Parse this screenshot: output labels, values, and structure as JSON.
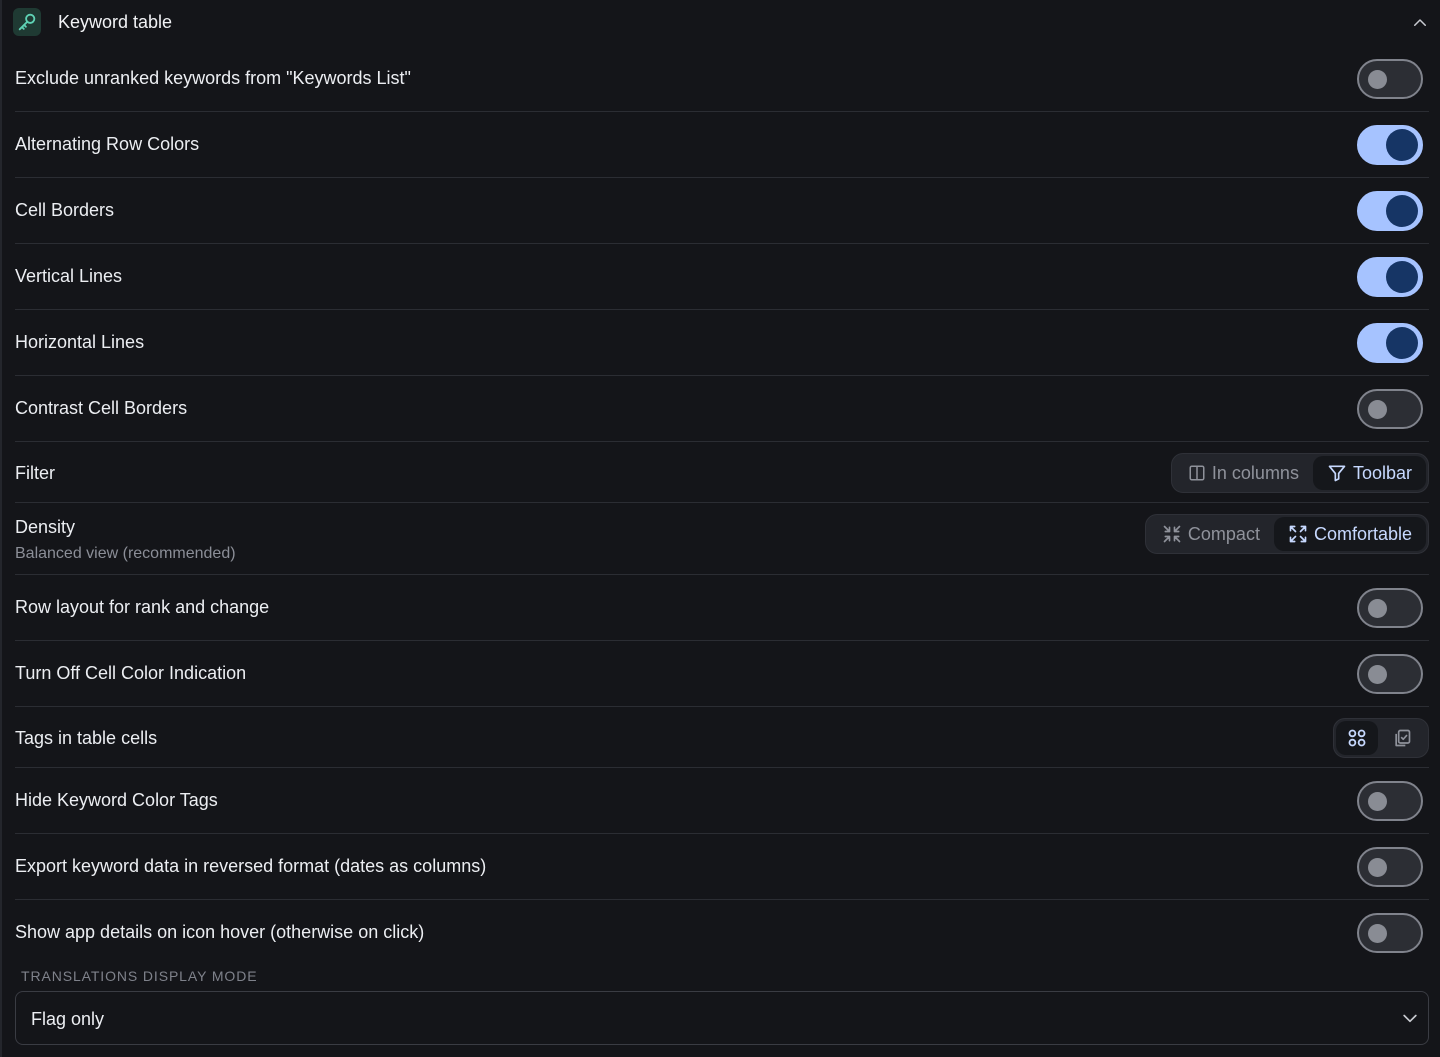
{
  "header": {
    "title": "Keyword table",
    "icon": "key-icon"
  },
  "colors": {
    "toggle_on_track": "#a6c3ff",
    "toggle_on_knob": "#163565",
    "toggle_off_track": "#2c2e34",
    "background": "#141519",
    "accent_text": "#c7d9ff"
  },
  "settings": [
    {
      "label": "Exclude unranked keywords from \"Keywords List\"",
      "on": false
    },
    {
      "label": "Alternating Row Colors",
      "on": true
    },
    {
      "label": "Cell Borders",
      "on": true
    },
    {
      "label": "Vertical Lines",
      "on": true
    },
    {
      "label": "Horizontal Lines",
      "on": true
    },
    {
      "label": "Contrast Cell Borders",
      "on": false
    }
  ],
  "filter": {
    "label": "Filter",
    "options": [
      "In columns",
      "Toolbar"
    ],
    "selected": "Toolbar"
  },
  "density": {
    "label": "Density",
    "description": "Balanced view (recommended)",
    "options": [
      "Compact",
      "Comfortable"
    ],
    "selected": "Comfortable"
  },
  "settings2": [
    {
      "label": "Row layout for rank and change",
      "on": false
    },
    {
      "label": "Turn Off Cell Color Indication",
      "on": false
    }
  ],
  "tags": {
    "label": "Tags in table cells",
    "options": [
      "grid-view-icon",
      "copy-list-icon"
    ],
    "selected": "grid-view-icon"
  },
  "settings3": [
    {
      "label": "Hide Keyword Color Tags",
      "on": false
    },
    {
      "label": "Export keyword data in reversed format (dates as columns)",
      "on": false
    },
    {
      "label": "Show app details on icon hover (otherwise on click)",
      "on": false
    }
  ],
  "translations": {
    "caption": "TRANSLATIONS DISPLAY MODE",
    "value": "Flag only"
  }
}
